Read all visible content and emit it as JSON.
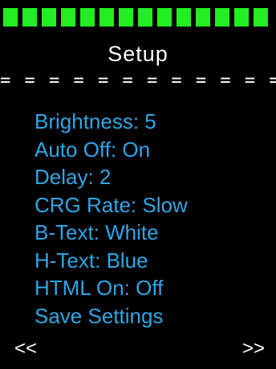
{
  "colors": {
    "background": "#000000",
    "segment": "#22ee22",
    "menu_text": "#2ea6e8",
    "text": "#ffffff"
  },
  "level_bar": {
    "segment_count": 14
  },
  "header": {
    "title": "Setup",
    "divider": "= = = = = = = = = = = = = = = = = = ="
  },
  "menu": {
    "items": [
      {
        "label": "Brightness: 5"
      },
      {
        "label": "Auto Off: On"
      },
      {
        "label": "Delay: 2"
      },
      {
        "label": "CRG Rate: Slow"
      },
      {
        "label": "B-Text: White"
      },
      {
        "label": "H-Text: Blue"
      },
      {
        "label": "HTML On: Off"
      },
      {
        "label": "Save Settings"
      }
    ]
  },
  "footer": {
    "prev_label": "<<",
    "next_label": ">>"
  }
}
